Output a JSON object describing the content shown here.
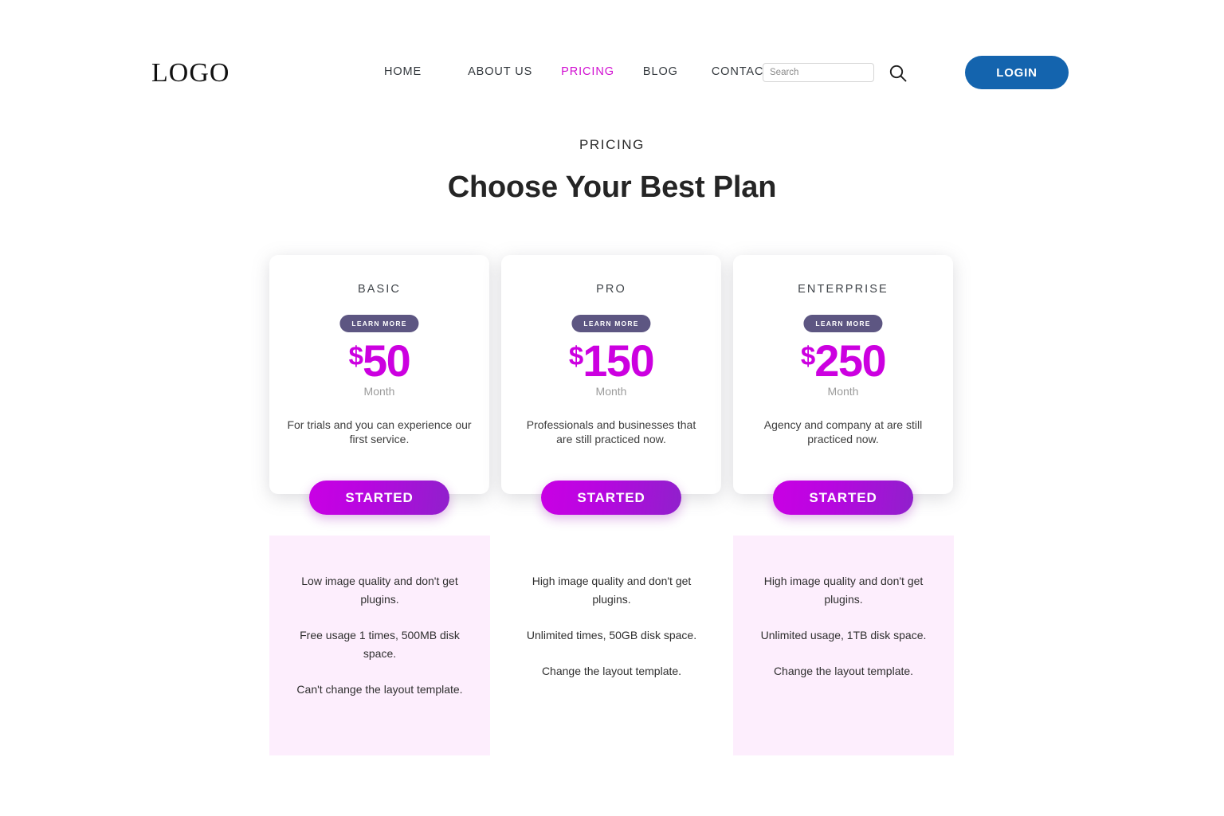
{
  "header": {
    "logo": "LOGO",
    "nav": [
      {
        "label": "HOME"
      },
      {
        "label": "ABOUT US"
      },
      {
        "label": "PRICING"
      },
      {
        "label": "BLOG"
      },
      {
        "label": "CONTACT"
      }
    ],
    "search": {
      "value": "",
      "placeholder": "Search"
    },
    "search_icon": "search-icon",
    "login_label": "LOGIN",
    "active_nav": "PRICING",
    "colors": {
      "active_nav": "#d10fd1",
      "login_bg": "#1464ae"
    }
  },
  "section": {
    "eyebrow": "PRICING",
    "title": "Choose Your Best Plan"
  },
  "plans": [
    {
      "name": "BASIC",
      "badge": "LEARN MORE",
      "currency": "$",
      "amount": "50",
      "period": "Month",
      "description": "For trials and you can experience our first service.",
      "cta": "STARTED",
      "features": [
        "Low image quality and don't get plugins.",
        "Free usage 1 times, 500MB disk space.",
        "Can't change the layout template."
      ],
      "panel_bg": "#fdeefd"
    },
    {
      "name": "PRO",
      "badge": "LEARN MORE",
      "currency": "$",
      "amount": "150",
      "period": "Month",
      "description": "Professionals and businesses that are still practiced now.",
      "cta": "STARTED",
      "features": [
        "High image quality and don't get plugins.",
        "Unlimited times, 50GB disk space.",
        "Change the layout template."
      ],
      "panel_bg": "#ffffff"
    },
    {
      "name": "ENTERPRISE",
      "badge": "LEARN MORE",
      "currency": "$",
      "amount": "250",
      "period": "Month",
      "description": "Agency and company at are still practiced now.",
      "cta": "STARTED",
      "features": [
        "High image quality and don't get plugins.",
        "Unlimited usage, 1TB disk space.",
        "Change the layout template."
      ],
      "panel_bg": "#fdeefd"
    }
  ],
  "colors": {
    "price": "#cc00e0",
    "badge_bg": "#5d5682",
    "cta_gradient_from": "#c900e4",
    "cta_gradient_to": "#9020cc"
  }
}
